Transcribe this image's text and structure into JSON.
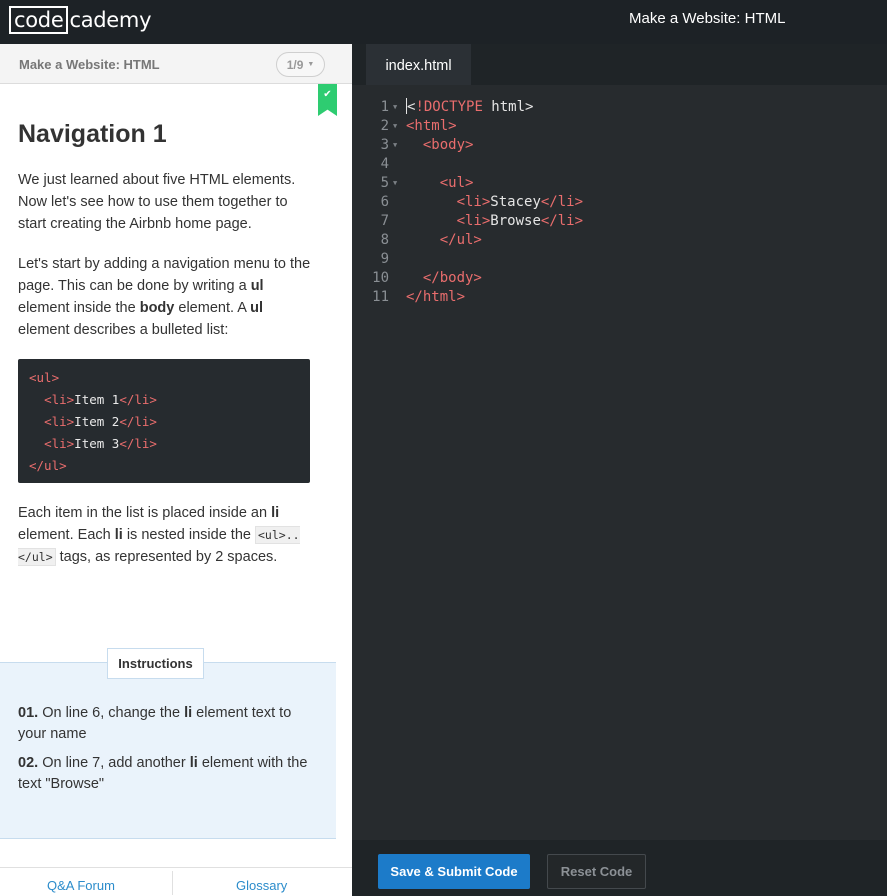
{
  "topbar": {
    "logo_boxed": "code",
    "logo_rest": "cademy",
    "course_title": "Make a Website: HTML"
  },
  "lesson": {
    "course_name": "Make a Website: HTML",
    "progress": "1/9",
    "title": "Navigation 1",
    "paragraphs": {
      "p1": "We just learned about five HTML elements. Now let's see how to use them together to start creating the Airbnb home page.",
      "p2_a": "Let's start by adding a navigation menu to the page. This can be done by writing a ",
      "p2_b": "ul",
      "p2_c": " element inside the ",
      "p2_d": "body",
      "p2_e": " element. A ",
      "p2_f": "ul",
      "p2_g": " element describes a bulleted list:",
      "p3_a": "Each item in the list is placed inside an ",
      "p3_b": "li",
      "p3_c": " element. Each ",
      "p3_d": "li",
      "p3_e": " is nested inside the ",
      "p3_code": "<ul>..</ul>",
      "p3_f": " tags, as represented by 2 spaces."
    },
    "example_code": {
      "open_ul": "<ul>",
      "items": [
        "Item 1",
        "Item 2",
        "Item 3"
      ],
      "li_open": "<li>",
      "li_close": "</li>",
      "close_ul": "</ul>"
    }
  },
  "instructions": {
    "label": "Instructions",
    "items": [
      {
        "num": "01.",
        "a": " On line 6, change the ",
        "b": "li",
        "c": " element text to your name"
      },
      {
        "num": "02.",
        "a": " On line 7, add another ",
        "b": "li",
        "c": " element with the text \"Browse\""
      }
    ]
  },
  "left_footer": {
    "qa": "Q&A Forum",
    "glossary": "Glossary"
  },
  "editor": {
    "tab": "index.html",
    "line_numbers": [
      "1",
      "2",
      "3",
      "4",
      "5",
      "6",
      "7",
      "8",
      "9",
      "10",
      "11"
    ],
    "lines": {
      "l1_tag": "!DOCTYPE",
      "l1_txt": " html>",
      "l1_lt": "<",
      "l2": "<html>",
      "l3": "<body>",
      "l5": "<ul>",
      "l6_open": "<li>",
      "l6_txt": "Stacey",
      "l6_close": "</li>",
      "l7_open": "<li>",
      "l7_txt": "Browse",
      "l7_close": "</li>",
      "l8": "</ul>",
      "l10": "</body>",
      "l11": "</html>"
    },
    "submit": "Save & Submit Code",
    "reset": "Reset Code"
  },
  "colors": {
    "accent_blue": "#1c7bc9",
    "tag_red": "#e96d6d",
    "complete_green": "#2ecc71"
  }
}
